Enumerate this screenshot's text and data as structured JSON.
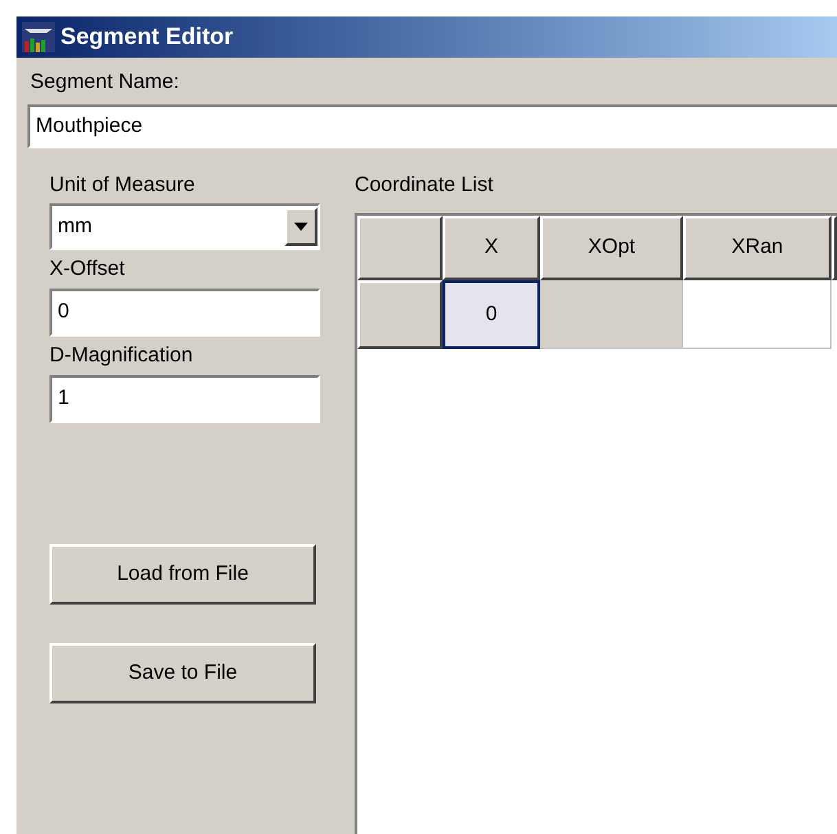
{
  "window": {
    "title": "Segment Editor"
  },
  "segment_name": {
    "label": "Segment Name:",
    "value": "Mouthpiece"
  },
  "unit_of_measure": {
    "label": "Unit of Measure",
    "value": "mm"
  },
  "x_offset": {
    "label": "X-Offset",
    "value": "0"
  },
  "d_magnification": {
    "label": "D-Magnification",
    "value": "1"
  },
  "buttons": [
    "Load from File",
    "Save to File"
  ],
  "coordinate_list": {
    "label": "Coordinate List",
    "columns": [
      "X",
      "XOpt",
      "XRan"
    ],
    "rows": [
      {
        "cells": [
          {
            "value": "0",
            "selected": true,
            "disabled": false
          },
          {
            "selected": false,
            "disabled": true
          },
          {
            "selected": false,
            "disabled": false
          }
        ]
      }
    ]
  }
}
